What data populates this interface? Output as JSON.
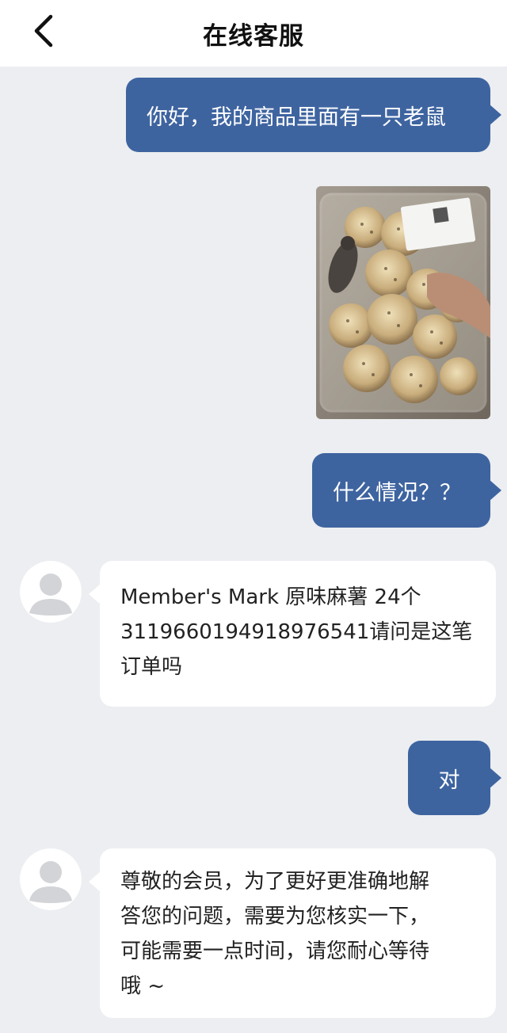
{
  "header": {
    "title": "在线客服",
    "back_icon": "chevron-left-icon"
  },
  "messages": [
    {
      "sender": "user",
      "type": "text",
      "text": "你好，我的商品里面有一只老鼠"
    },
    {
      "sender": "user",
      "type": "image",
      "image_description_icon": "photo-icon"
    },
    {
      "sender": "user",
      "type": "text",
      "text": "什么情况？？"
    },
    {
      "sender": "agent",
      "type": "text",
      "lines": [
        "Member's Mark 原味麻薯 24个",
        "3119660194918976541请问是这笔",
        "订单吗"
      ]
    },
    {
      "sender": "user",
      "type": "text",
      "text": "对"
    },
    {
      "sender": "agent",
      "type": "text",
      "lines": [
        "尊敬的会员，为了更好更准确地解",
        "答您的问题，需要为您核实一下，",
        "可能需要一点时间，请您耐心等待",
        "哦 ~"
      ]
    }
  ],
  "colors": {
    "header_bg": "#ffffff",
    "chat_bg": "#eceef1",
    "user_bubble": "#3e64a0",
    "agent_bubble": "#ffffff"
  }
}
